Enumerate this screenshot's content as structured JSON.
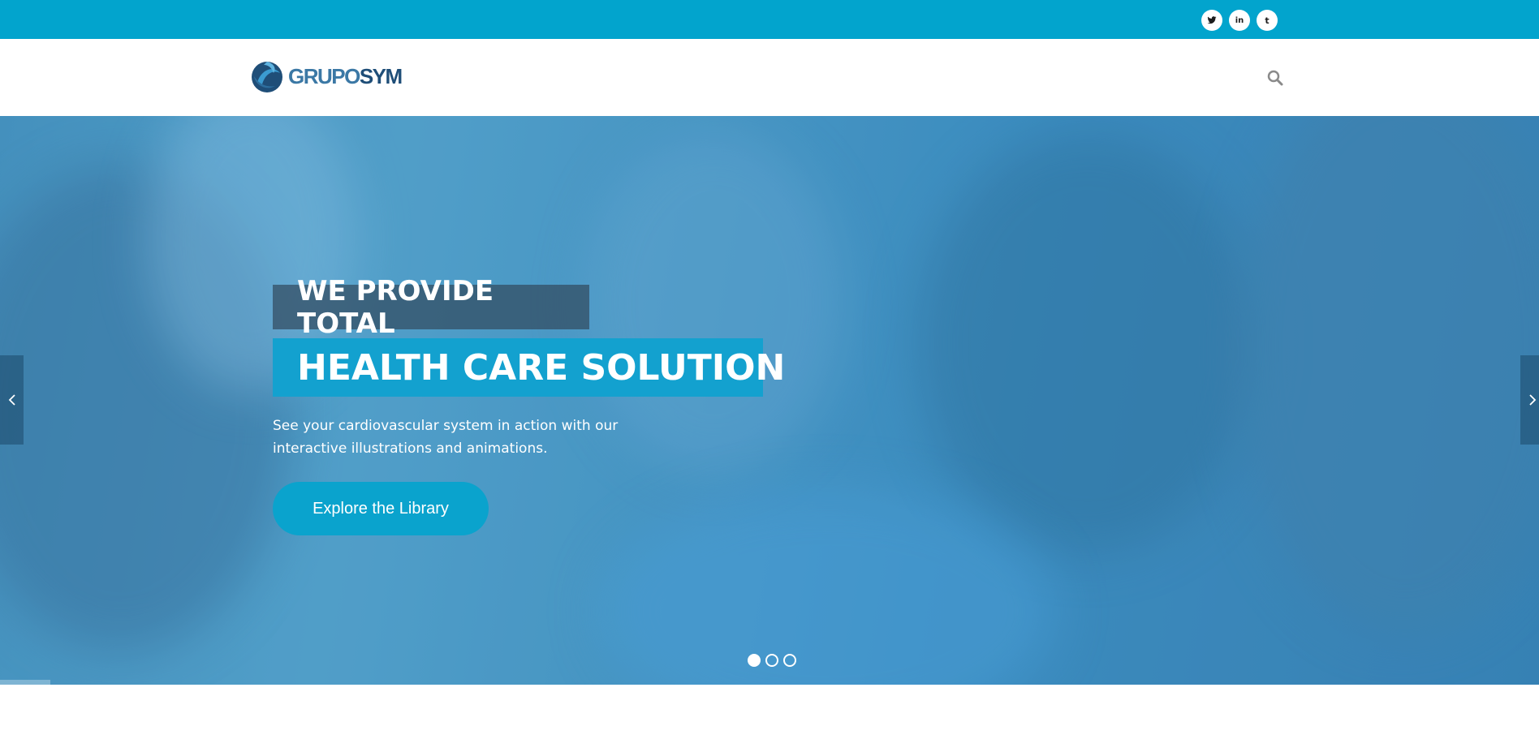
{
  "social": {
    "twitter_glyph": "𝕏",
    "linkedin_glyph": "in",
    "tumblr_glyph": "t"
  },
  "header": {
    "logo_text_light": "GRUPO",
    "logo_text_dark": "SYM"
  },
  "hero": {
    "line1": "WE PROVIDE TOTAL",
    "line2": "HEALTH CARE SOLUTION",
    "description": "See your cardiovascular system in action with our interactive illustrations and animations.",
    "cta_label": "Explore the Library",
    "slides_total": 3,
    "active_slide": 1
  },
  "colors": {
    "topbar": "#02a4cd",
    "accent": "#13a1cf",
    "tag_dark": "#324b5f"
  }
}
